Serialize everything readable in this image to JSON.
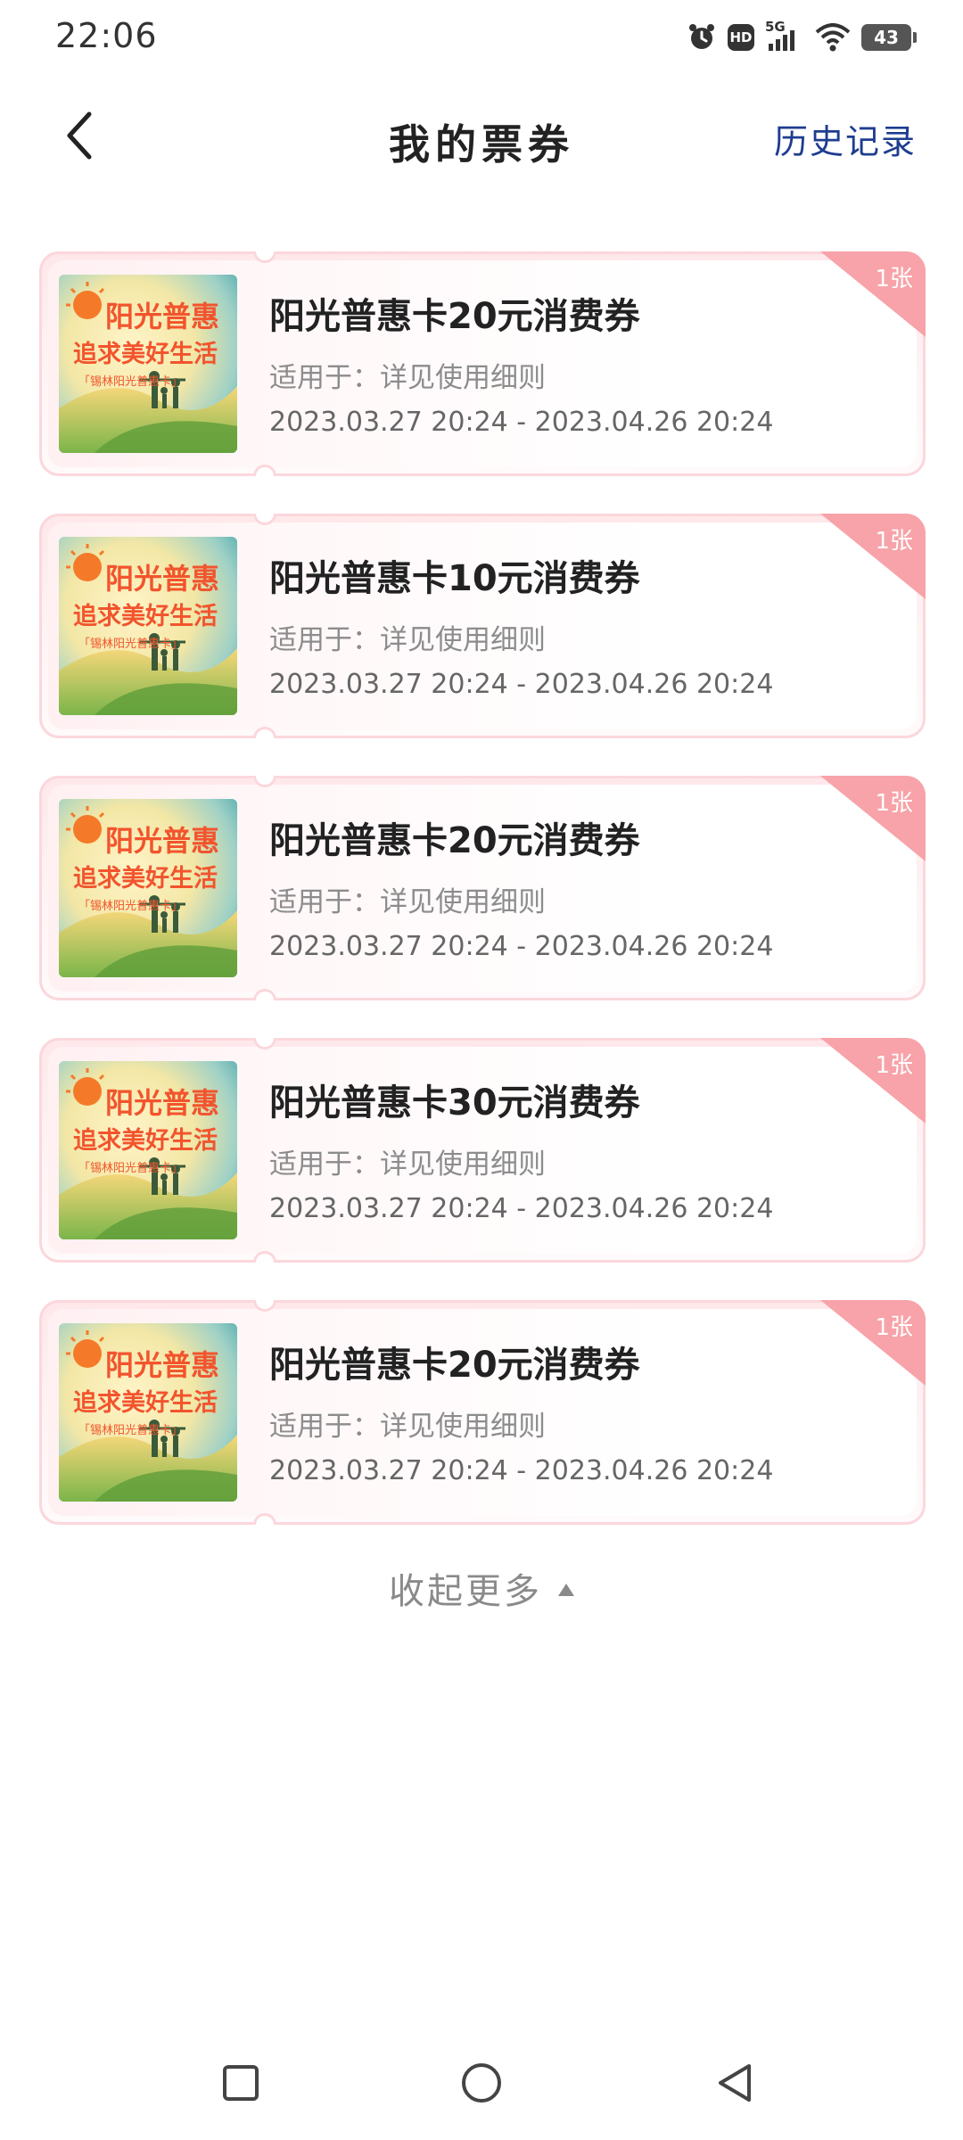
{
  "status_bar": {
    "time": "22:06",
    "network": "5G",
    "hd": "HD",
    "battery": "43"
  },
  "header": {
    "title": "我的票券",
    "history": "历史记录"
  },
  "coupon_image_text": {
    "line1": "阳光普惠",
    "line2": "追求美好生活",
    "line3": "「锡林阳光普惠卡」"
  },
  "coupons": [
    {
      "title": "阳光普惠卡20元消费券",
      "scope": "适用于：详见使用细则",
      "validity": "2023.03.27 20:24 - 2023.04.26 20:24",
      "count": "1张"
    },
    {
      "title": "阳光普惠卡10元消费券",
      "scope": "适用于：详见使用细则",
      "validity": "2023.03.27 20:24 - 2023.04.26 20:24",
      "count": "1张"
    },
    {
      "title": "阳光普惠卡20元消费券",
      "scope": "适用于：详见使用细则",
      "validity": "2023.03.27 20:24 - 2023.04.26 20:24",
      "count": "1张"
    },
    {
      "title": "阳光普惠卡30元消费券",
      "scope": "适用于：详见使用细则",
      "validity": "2023.03.27 20:24 - 2023.04.26 20:24",
      "count": "1张"
    },
    {
      "title": "阳光普惠卡20元消费券",
      "scope": "适用于：详见使用细则",
      "validity": "2023.03.27 20:24 - 2023.04.26 20:24",
      "count": "1张"
    }
  ],
  "collapse_label": "收起更多",
  "colors": {
    "accent_link": "#1e3d8f",
    "badge": "#f7a3a9",
    "coupon_border": "#fbd7dc"
  },
  "icons": {
    "back": "chevron-left-icon",
    "alarm": "alarm-icon",
    "signal": "signal-icon",
    "wifi": "wifi-icon",
    "battery": "battery-icon",
    "collapse": "caret-up-icon",
    "nav_recent": "square-icon",
    "nav_home": "circle-icon",
    "nav_back": "triangle-back-icon"
  }
}
